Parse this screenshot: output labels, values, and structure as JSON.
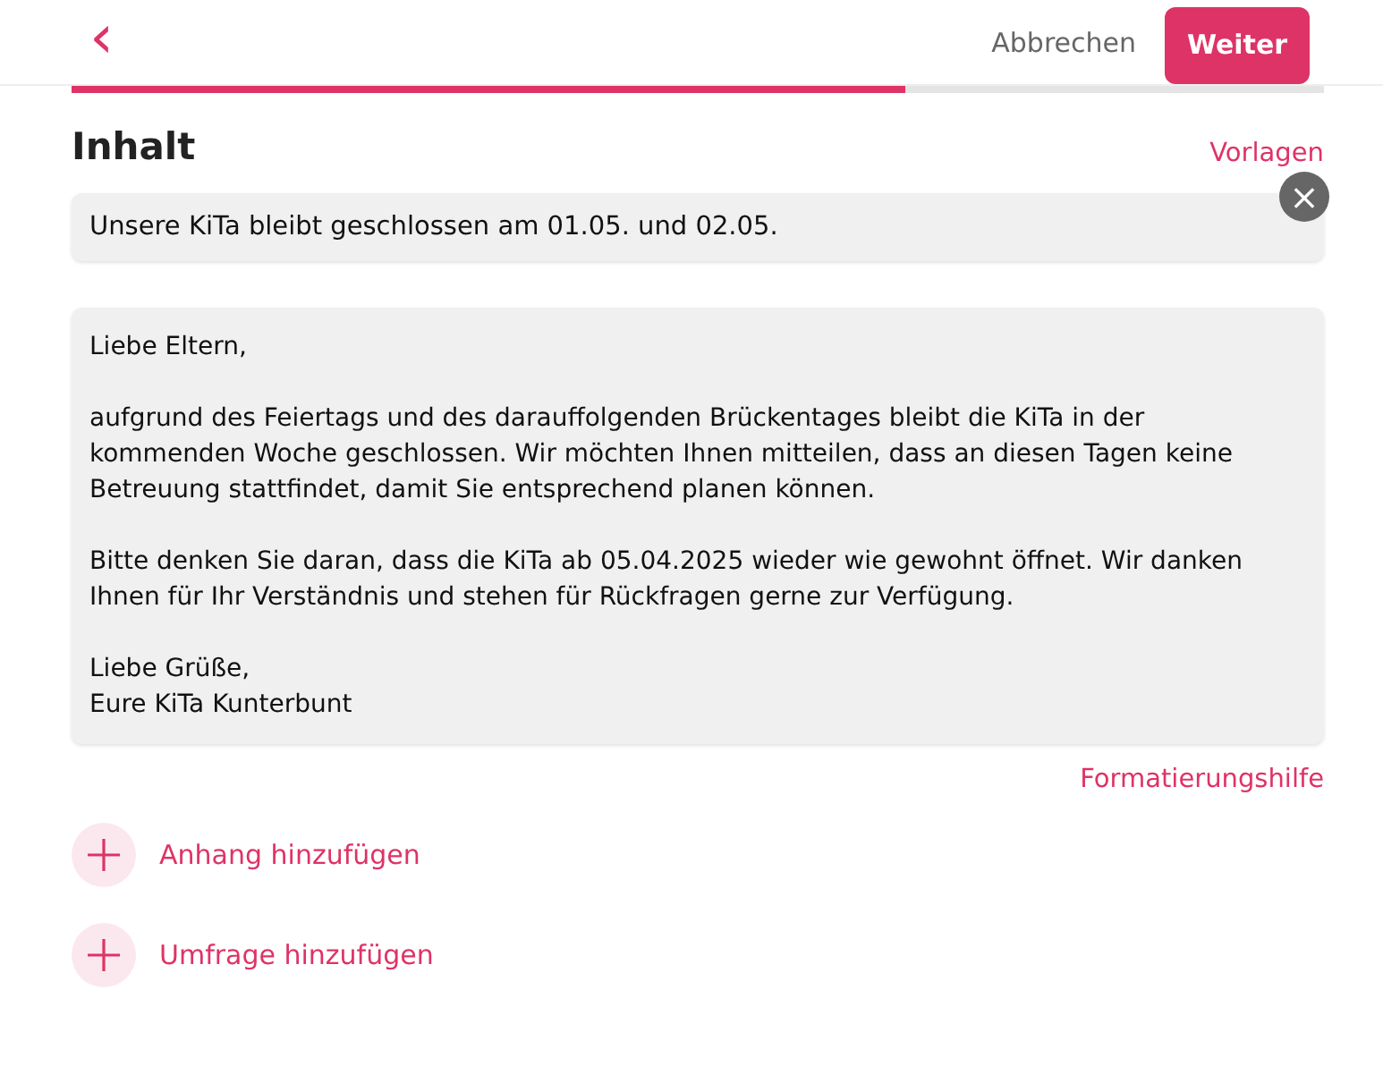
{
  "header": {
    "back": "‹",
    "cancel": "Abbrechen",
    "next": "Weiter"
  },
  "progress": {
    "level": 0.666
  },
  "section": {
    "title": "Inhalt",
    "templates_link": "Vorlagen"
  },
  "subject": {
    "value": "Unsere KiTa bleibt geschlossen am 01.05. und 02.05.",
    "clear": "×"
  },
  "body": {
    "value": "Liebe Eltern,\n\naufgrund des Feiertags und des darauffolgenden Brückentages bleibt die KiTa in der kommenden Woche geschlossen. Wir möchten Ihnen mitteilen, dass an diesen Tagen keine Betreuung stattfindet, damit Sie entsprechend planen können.\n\nBitte denken Sie daran, dass die KiTa ab 05.04.2025 wieder wie gewohnt öffnet. Wir danken Ihnen für Ihr Verständnis und stehen für Rückfragen gerne zur Verfügung.\n\nLiebe Grüße,\nEure KiTa Kunterbunt"
  },
  "format_help": "Formatierungshilfe",
  "actions": [
    {
      "label": "Anhang hinzufügen"
    },
    {
      "label": "Umfrage hinzufügen"
    }
  ]
}
